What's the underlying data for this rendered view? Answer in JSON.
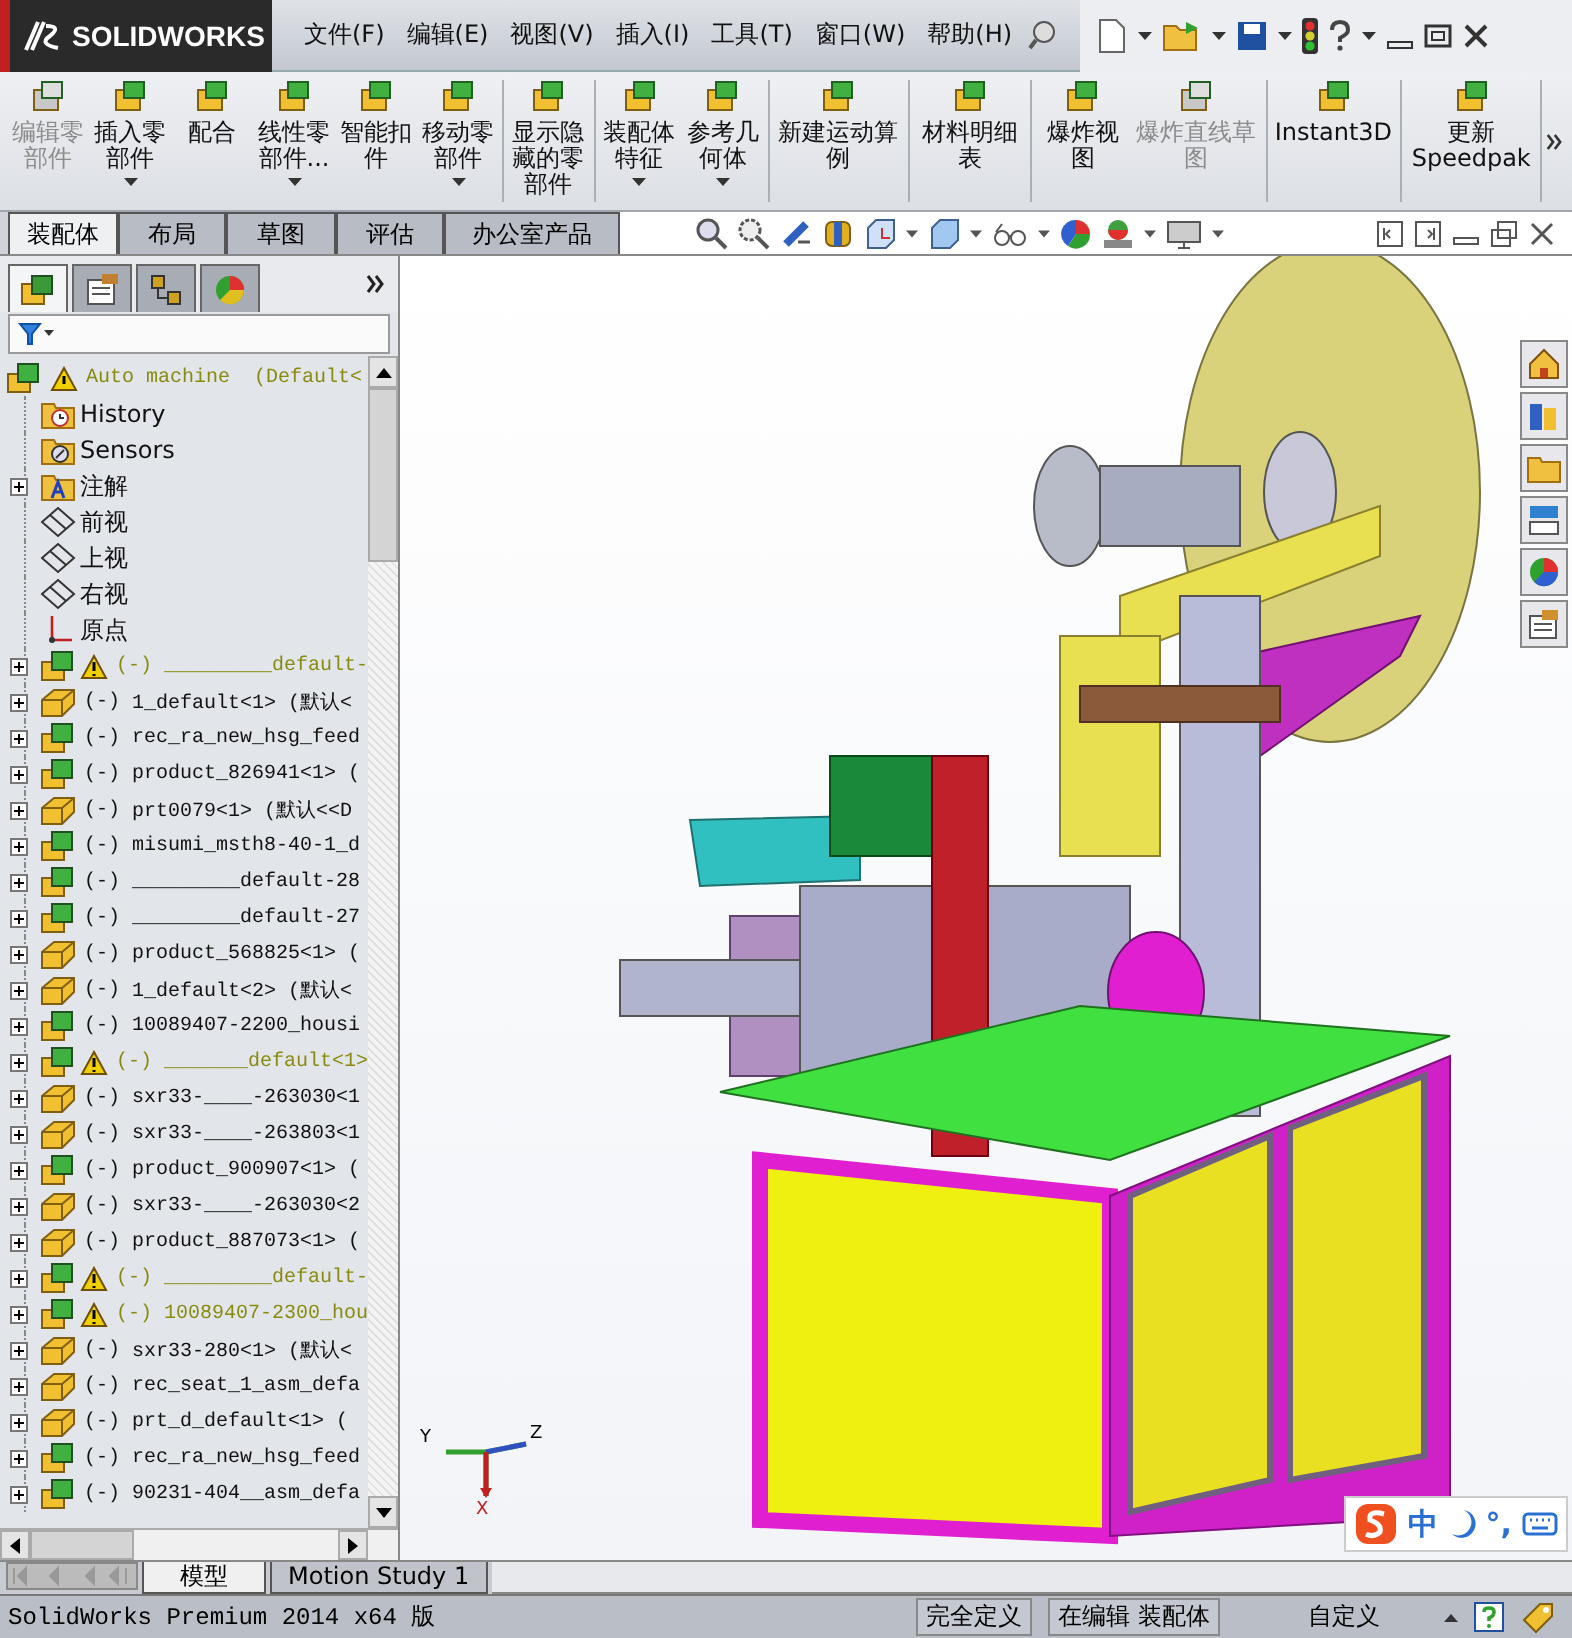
{
  "title_bar": {
    "logo": "SOLIDWORKS",
    "menu": [
      "文件(F)",
      "编辑(E)",
      "视图(V)",
      "插入(I)",
      "工具(T)",
      "窗口(W)",
      "帮助(H)"
    ]
  },
  "command_manager": {
    "groups": [
      [
        {
          "label": "编辑零部件",
          "disabled": true,
          "dropdown": false
        },
        {
          "label": "插入零部件",
          "disabled": false,
          "dropdown": true
        },
        {
          "label": "配合",
          "disabled": false,
          "dropdown": false
        },
        {
          "label": "线性零部件...",
          "disabled": false,
          "dropdown": true
        },
        {
          "label": "智能扣件",
          "disabled": false,
          "dropdown": false
        },
        {
          "label": "移动零部件",
          "disabled": false,
          "dropdown": true
        }
      ],
      [
        {
          "label": "显示隐藏的零部件",
          "disabled": false,
          "dropdown": false
        }
      ],
      [
        {
          "label": "装配体特征",
          "disabled": false,
          "dropdown": true
        },
        {
          "label": "参考几何体",
          "disabled": false,
          "dropdown": true
        }
      ],
      [
        {
          "label": "新建运动算例",
          "disabled": false,
          "dropdown": false
        }
      ],
      [
        {
          "label": "材料明细表",
          "disabled": false,
          "dropdown": false
        }
      ],
      [
        {
          "label": "爆炸视图",
          "disabled": false,
          "dropdown": false
        },
        {
          "label": "爆炸直线草图",
          "disabled": true,
          "dropdown": false
        }
      ],
      [
        {
          "label": "Instant3D",
          "disabled": false,
          "dropdown": false
        }
      ],
      [
        {
          "label": "更新 Speedpak",
          "disabled": false,
          "dropdown": false
        }
      ]
    ]
  },
  "tabs": [
    {
      "label": "装配体",
      "selected": true
    },
    {
      "label": "布局",
      "selected": false
    },
    {
      "label": "草图",
      "selected": false
    },
    {
      "label": "评估",
      "selected": false
    },
    {
      "label": "办公室产品",
      "selected": false
    }
  ],
  "panel_tabs": [
    {
      "kind": "feature",
      "selected": true
    },
    {
      "kind": "property",
      "selected": false
    },
    {
      "kind": "configuration",
      "selected": false
    },
    {
      "kind": "appearance",
      "selected": false
    }
  ],
  "feature_tree": {
    "name": "Auto machine",
    "config": "(Default<",
    "warning": true,
    "children": [
      {
        "kind": "history",
        "name": "History",
        "warning": false,
        "expandable": false
      },
      {
        "kind": "sensors",
        "name": "Sensors",
        "warning": false,
        "expandable": false
      },
      {
        "kind": "annotations",
        "name": "注解",
        "warning": false,
        "expandable": true
      },
      {
        "kind": "plane",
        "name": "前视",
        "warning": false,
        "expandable": false
      },
      {
        "kind": "plane",
        "name": "上视",
        "warning": false,
        "expandable": false
      },
      {
        "kind": "plane",
        "name": "右视",
        "warning": false,
        "expandable": false
      },
      {
        "kind": "origin",
        "name": "原点",
        "warning": false,
        "expandable": false
      },
      {
        "kind": "assembly",
        "state": "(-)",
        "name": "_________default-",
        "warning": true,
        "expandable": true
      },
      {
        "kind": "part",
        "state": "(-)",
        "name": "1_default<1> (默认<",
        "warning": false,
        "expandable": true
      },
      {
        "kind": "assembly",
        "state": "(-)",
        "name": "rec_ra_new_hsg_feed",
        "warning": false,
        "expandable": true
      },
      {
        "kind": "assembly",
        "state": "(-)",
        "name": "product_826941<1> (",
        "warning": false,
        "expandable": true
      },
      {
        "kind": "part",
        "state": "(-)",
        "name": "prt0079<1> (默认<<D",
        "warning": false,
        "expandable": true
      },
      {
        "kind": "assembly",
        "state": "(-)",
        "name": "misumi_msth8-40-1_d",
        "warning": false,
        "expandable": true
      },
      {
        "kind": "assembly",
        "state": "(-)",
        "name": "_________default-28",
        "warning": false,
        "expandable": true
      },
      {
        "kind": "assembly",
        "state": "(-)",
        "name": "_________default-27",
        "warning": false,
        "expandable": true
      },
      {
        "kind": "part",
        "state": "(-)",
        "name": "product_568825<1> (",
        "warning": false,
        "expandable": true
      },
      {
        "kind": "part",
        "state": "(-)",
        "name": "1_default<2> (默认<",
        "warning": false,
        "expandable": true
      },
      {
        "kind": "assembly",
        "state": "(-)",
        "name": "10089407-2200_housi",
        "warning": false,
        "expandable": true
      },
      {
        "kind": "assembly",
        "state": "(-)",
        "name": "_______default<1>",
        "warning": true,
        "expandable": true
      },
      {
        "kind": "part",
        "state": "(-)",
        "name": "sxr33-____-263030<1",
        "warning": false,
        "expandable": true
      },
      {
        "kind": "part",
        "state": "(-)",
        "name": "sxr33-____-263803<1",
        "warning": false,
        "expandable": true
      },
      {
        "kind": "assembly",
        "state": "(-)",
        "name": "product_900907<1> (",
        "warning": false,
        "expandable": true
      },
      {
        "kind": "part",
        "state": "(-)",
        "name": "sxr33-____-263030<2",
        "warning": false,
        "expandable": true
      },
      {
        "kind": "part",
        "state": "(-)",
        "name": "product_887073<1> (",
        "warning": false,
        "expandable": true
      },
      {
        "kind": "assembly",
        "state": "(-)",
        "name": "_________default-",
        "warning": true,
        "expandable": true
      },
      {
        "kind": "assembly",
        "state": "(-)",
        "name": "10089407-2300_hou",
        "warning": true,
        "expandable": true
      },
      {
        "kind": "part",
        "state": "(-)",
        "name": "sxr33-280<1> (默认<",
        "warning": false,
        "expandable": true
      },
      {
        "kind": "part",
        "state": "(-)",
        "name": "rec_seat_1_asm_defa",
        "warning": false,
        "expandable": true
      },
      {
        "kind": "part",
        "state": "(-)",
        "name": "prt_d_default<1> (",
        "warning": false,
        "expandable": true
      },
      {
        "kind": "assembly",
        "state": "(-)",
        "name": "rec_ra_new_hsg_feed",
        "warning": false,
        "expandable": true
      },
      {
        "kind": "assembly",
        "state": "(-)",
        "name": "90231-404__asm_defa",
        "warning": false,
        "expandable": true
      }
    ]
  },
  "bottom_tabs": [
    {
      "label": "模型",
      "selected": true
    },
    {
      "label": "Motion Study 1",
      "selected": false
    }
  ],
  "triad": {
    "y": "Y",
    "z": "Z",
    "x": "X"
  },
  "ime": {
    "mode": "中",
    "punctuation": "°,"
  },
  "status_bar": {
    "product": "SolidWorks Premium 2014 x64 版",
    "fields": [
      "完全定义",
      "在编辑 装配体",
      "自定义"
    ]
  }
}
